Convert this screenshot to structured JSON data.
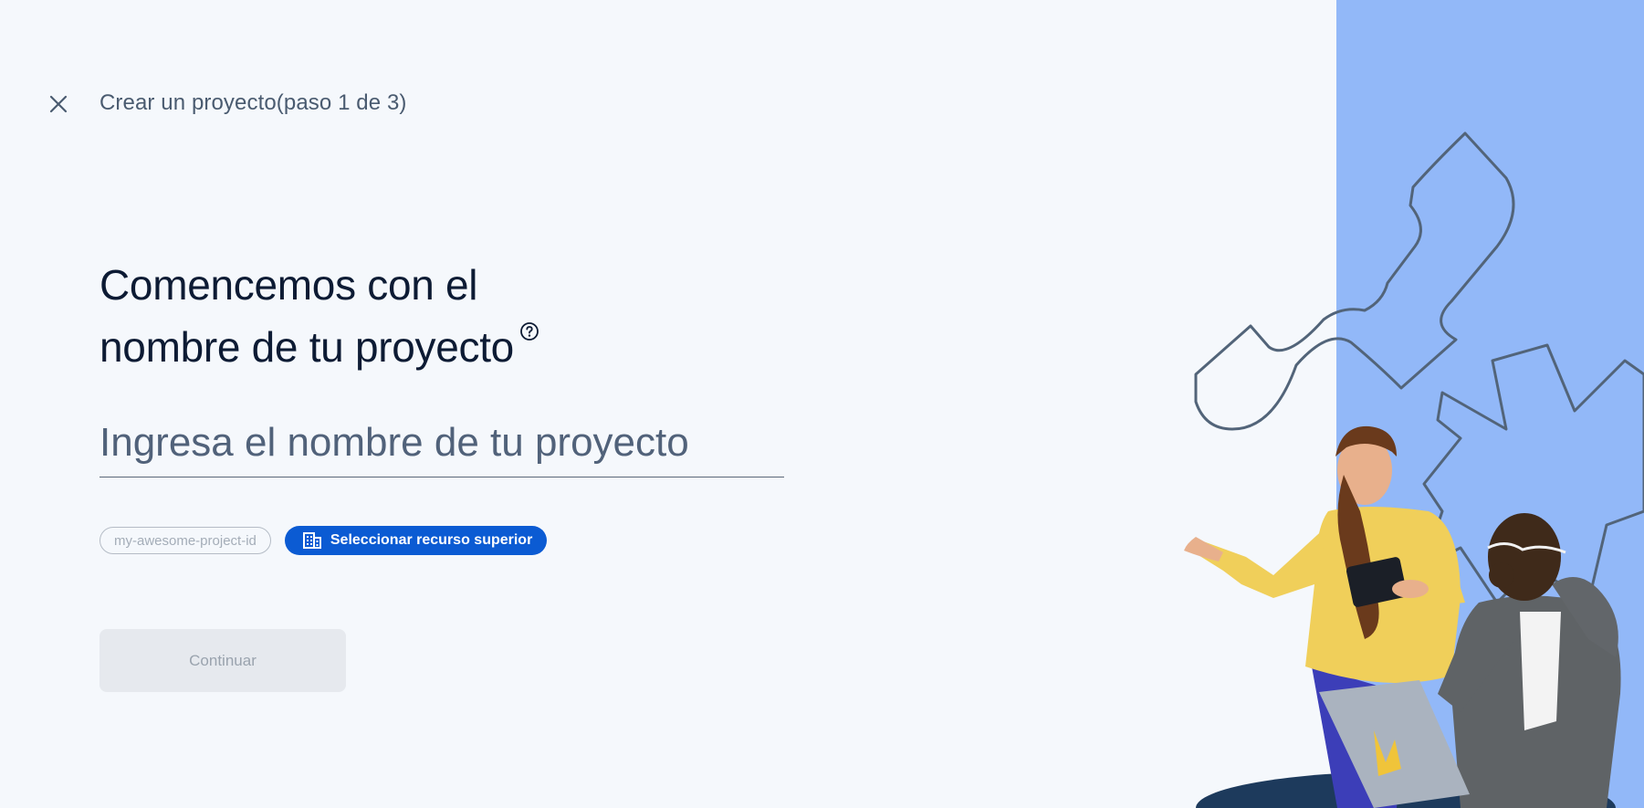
{
  "header": {
    "title": "Crear un proyecto(paso 1 de 3)",
    "close_icon": "close-icon"
  },
  "main": {
    "heading_line1": "Comencemos con el",
    "heading_line2": "nombre de tu proyecto",
    "help_icon": "help-circle-icon",
    "project_name_input": {
      "placeholder": "Ingresa el nombre de tu proyecto",
      "value": ""
    },
    "project_id_chip": "my-awesome-project-id",
    "parent_resource_button": "Seleccionar recurso superior",
    "parent_resource_icon": "domain-building-icon",
    "continue_button": "Continuar"
  },
  "colors": {
    "background": "#f5f8fc",
    "accent": "#0b5bd3",
    "right_panel": "#92b8f8",
    "heading": "#0d1b34",
    "disabled_button": "#e6e9ee"
  }
}
